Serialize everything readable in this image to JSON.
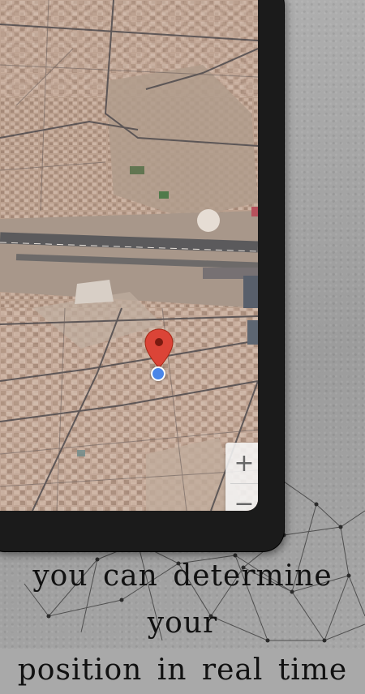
{
  "caption": {
    "line1": "you can determine your",
    "line2": "position in real time"
  },
  "map": {
    "zoom_in_label": "+",
    "zoom_out_label": "−",
    "pin_color": "#db4437",
    "location_dot_color": "#4a86e8"
  }
}
